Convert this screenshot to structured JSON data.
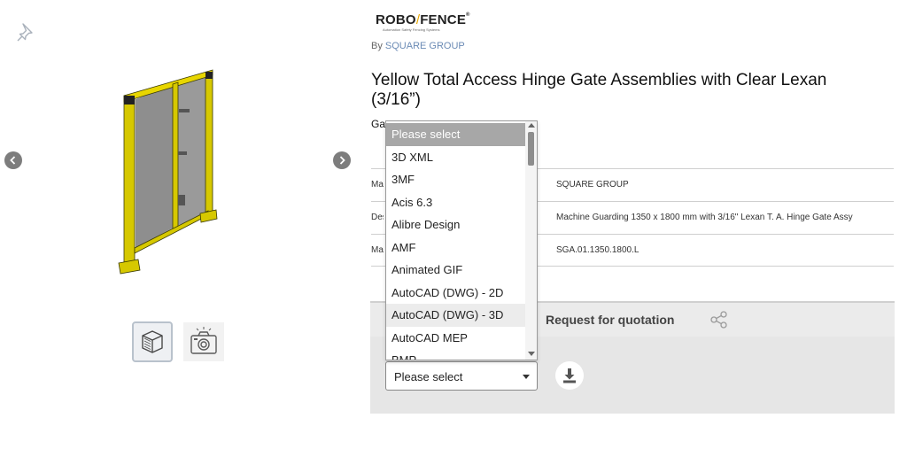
{
  "brand": {
    "logo_left": "ROBO",
    "logo_slash": "/",
    "logo_right": "FENCE",
    "logo_reg": "®",
    "logo_tagline": "Automation Safety Fencing Systems",
    "by_prefix": "By",
    "by_company": "SQUARE GROUP"
  },
  "product": {
    "title": "Yellow Total Access Hinge Gate Assemblies with Clear Lexan (3/16”)",
    "gate_label": "Ga"
  },
  "specs": [
    {
      "key": "Ma",
      "value": "SQUARE GROUP"
    },
    {
      "key": "Des",
      "value": "Machine Guarding 1350 x 1800 mm with 3/16\" Lexan T. A. Hinge Gate Assy"
    },
    {
      "key": "Mar",
      "value": "SGA.01.1350.1800.L"
    }
  ],
  "tabs": {
    "request_quotation": "Request for quotation"
  },
  "download": {
    "select_value": "Please select"
  },
  "dropdown": {
    "items": [
      {
        "label": "Please select",
        "state": "selected"
      },
      {
        "label": "3D XML",
        "state": ""
      },
      {
        "label": "3MF",
        "state": ""
      },
      {
        "label": "Acis 6.3",
        "state": ""
      },
      {
        "label": "Alibre Design",
        "state": ""
      },
      {
        "label": "AMF",
        "state": ""
      },
      {
        "label": "Animated GIF",
        "state": ""
      },
      {
        "label": "AutoCAD (DWG) - 2D",
        "state": ""
      },
      {
        "label": "AutoCAD (DWG) - 3D",
        "state": "hover"
      },
      {
        "label": "AutoCAD MEP",
        "state": ""
      },
      {
        "label": "BMP",
        "state": ""
      }
    ]
  },
  "icons": {
    "pin": "pin-icon",
    "prev": "chevron-left-icon",
    "next": "chevron-right-icon",
    "cube": "3d-cube-icon",
    "camera": "camera-icon",
    "share": "share-icon",
    "download": "download-icon"
  },
  "colors": {
    "accent_yellow": "#e8d100",
    "brand_blue": "#6b8bb5",
    "selected_item": "#a7a7a7"
  }
}
